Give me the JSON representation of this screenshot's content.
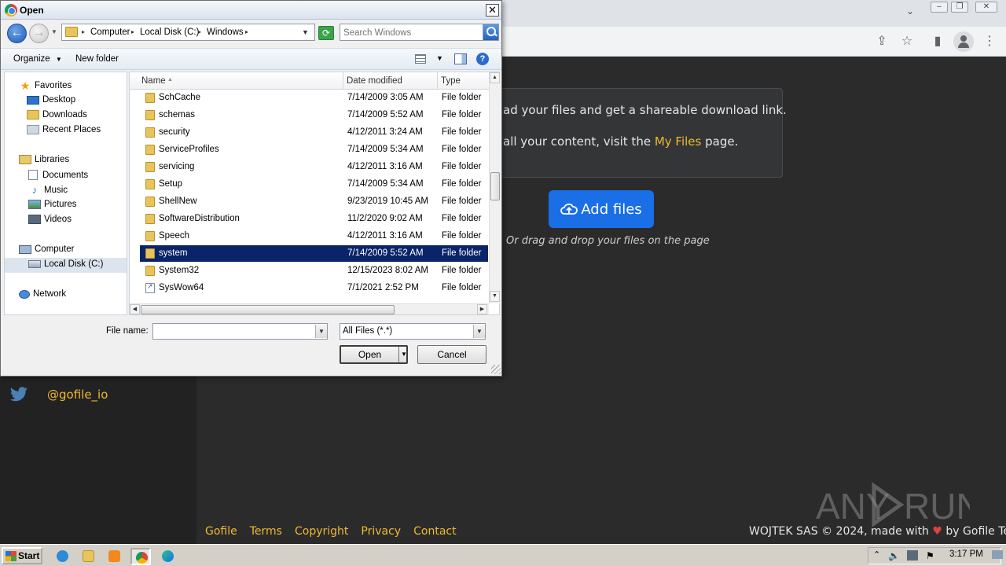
{
  "dialog": {
    "title": "Open",
    "close_glyph": "✕",
    "breadcrumbs": [
      "Computer",
      "Local Disk (C:)",
      "Windows"
    ],
    "search_placeholder": "Search Windows",
    "toolbar": {
      "organize": "Organize",
      "new_folder": "New folder"
    },
    "nav": {
      "favorites": "Favorites",
      "desktop": "Desktop",
      "downloads": "Downloads",
      "recent_places": "Recent Places",
      "libraries": "Libraries",
      "documents": "Documents",
      "music": "Music",
      "pictures": "Pictures",
      "videos": "Videos",
      "computer": "Computer",
      "local_disk": "Local Disk (C:)",
      "network": "Network"
    },
    "columns": {
      "name": "Name",
      "date_modified": "Date modified",
      "type": "Type"
    },
    "files": [
      {
        "name": "SchCache",
        "date": "7/14/2009 3:05 AM",
        "type": "File folder"
      },
      {
        "name": "schemas",
        "date": "7/14/2009 5:52 AM",
        "type": "File folder"
      },
      {
        "name": "security",
        "date": "4/12/2011 3:24 AM",
        "type": "File folder"
      },
      {
        "name": "ServiceProfiles",
        "date": "7/14/2009 5:34 AM",
        "type": "File folder"
      },
      {
        "name": "servicing",
        "date": "4/12/2011 3:16 AM",
        "type": "File folder"
      },
      {
        "name": "Setup",
        "date": "7/14/2009 5:34 AM",
        "type": "File folder"
      },
      {
        "name": "ShellNew",
        "date": "9/23/2019 10:45 AM",
        "type": "File folder"
      },
      {
        "name": "SoftwareDistribution",
        "date": "11/2/2020 9:02 AM",
        "type": "File folder"
      },
      {
        "name": "Speech",
        "date": "4/12/2011 3:16 AM",
        "type": "File folder"
      },
      {
        "name": "system",
        "date": "7/14/2009 5:52 AM",
        "type": "File folder"
      },
      {
        "name": "System32",
        "date": "12/15/2023 8:02 AM",
        "type": "File folder"
      },
      {
        "name": "SysWow64",
        "date": "7/1/2021 2:52 PM",
        "type": "File folder"
      }
    ],
    "selected_file": "system",
    "file_name_label": "File name:",
    "file_name_value": "",
    "filter_value": "All Files (*.*)",
    "open_label": "Open",
    "cancel_label": "Cancel"
  },
  "page": {
    "info_line1": "ad your files and get a shareable download link.",
    "info_line2_prefix": "all your content, visit the ",
    "info_line2_link": "My Files",
    "info_line2_suffix": " page.",
    "add_files": "Add files",
    "drag_drop": "Or drag and drop your files on the page",
    "twitter_handle": "@gofile_io",
    "footer_links": [
      "Gofile",
      "Terms",
      "Copyright",
      "Privacy",
      "Contact"
    ],
    "footer_right_prefix": "WOJTEK SAS © 2024, made with ",
    "footer_right_suffix": " by Gofile Team",
    "watermark": "ANY RUN"
  },
  "taskbar": {
    "start": "Start",
    "clock": "3:17 PM"
  },
  "colors": {
    "accent_yellow": "#f0b930",
    "button_blue": "#1a6ee6",
    "selection_navy": "#0a246a"
  }
}
